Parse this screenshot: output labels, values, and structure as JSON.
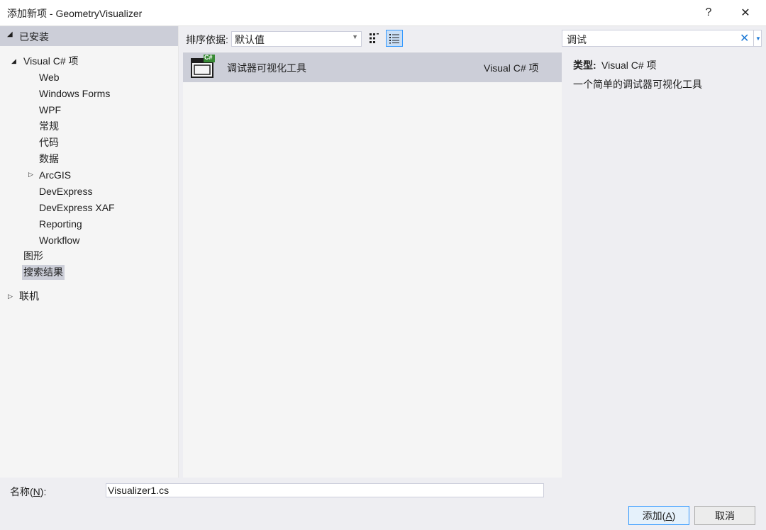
{
  "window": {
    "title": "添加新项 - GeometryVisualizer",
    "help_label": "?",
    "close_label": "✕"
  },
  "tree": {
    "installed_label": "已安装",
    "visual_csharp_label": "Visual C# 项",
    "children": [
      "Web",
      "Windows Forms",
      "WPF",
      "常规",
      "代码",
      "数据",
      "ArcGIS",
      "DevExpress",
      "DevExpress XAF",
      "Reporting",
      "Workflow"
    ],
    "graphics_label": "图形",
    "search_results_label": "搜索结果",
    "online_label": "联机"
  },
  "sort": {
    "label": "排序依据:",
    "value": "默认值"
  },
  "results": [
    {
      "name": "调试器可视化工具",
      "type": "Visual C# 项",
      "icon_badge": "C#"
    }
  ],
  "search": {
    "value": "调试",
    "clear_label": "✕"
  },
  "details": {
    "type_label": "类型:",
    "type_value": "Visual C# 项",
    "description": "一个简单的调试器可视化工具"
  },
  "footer": {
    "name_label_prefix": "名称(",
    "name_label_key": "N",
    "name_label_suffix": "):",
    "name_value": "Visualizer1.cs",
    "add_prefix": "添加(",
    "add_key": "A",
    "add_suffix": ")",
    "cancel_label": "取消"
  },
  "colors": {
    "selection": "#ccced8",
    "accent": "#3399ff",
    "icon_green": "#388a34"
  }
}
